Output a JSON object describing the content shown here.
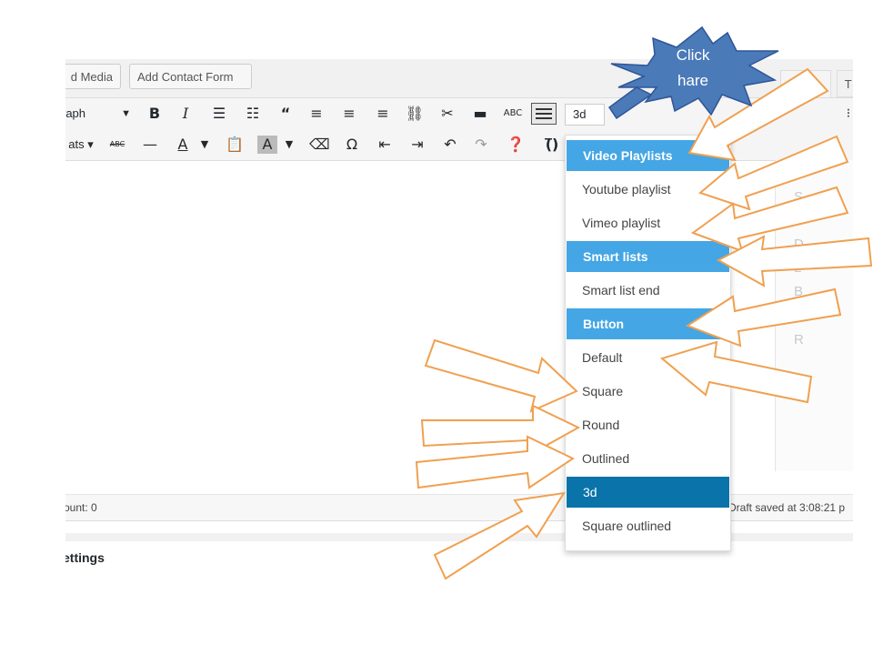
{
  "topbar": {
    "add_media_label": "d Media",
    "add_contact_form_label": "Add Contact Form",
    "tab_visual": "",
    "tab_text": "T"
  },
  "toolbar": {
    "format_select": "raph",
    "formats_label": "ats",
    "buttons_select_value": "3d",
    "icons": [
      "bold-icon",
      "italic-icon",
      "bullet-list-icon",
      "numbered-list-icon",
      "blockquote-icon",
      "align-left-icon",
      "align-center-icon",
      "align-right-icon",
      "link-icon",
      "unlink-icon",
      "read-more-icon",
      "spellcheck-icon",
      "keyboard-icon",
      "strikethrough-icon",
      "horizontal-line-icon",
      "text-color-icon",
      "paste-text-icon",
      "background-color-icon",
      "clear-format-icon",
      "omega-icon",
      "outdent-icon",
      "indent-icon",
      "undo-icon",
      "redo-icon",
      "help-icon",
      "shortcode-icon"
    ]
  },
  "dropdown": {
    "items": [
      {
        "label": "Video Playlists",
        "kind": "header"
      },
      {
        "label": "Youtube playlist",
        "kind": "item"
      },
      {
        "label": "Vimeo playlist",
        "kind": "item"
      },
      {
        "label": "Smart lists",
        "kind": "header"
      },
      {
        "label": "Smart list end",
        "kind": "item"
      },
      {
        "label": "Button",
        "kind": "header"
      },
      {
        "label": "Default",
        "kind": "item"
      },
      {
        "label": "Square",
        "kind": "item"
      },
      {
        "label": "Round",
        "kind": "item"
      },
      {
        "label": "Outlined",
        "kind": "item"
      },
      {
        "label": "3d",
        "kind": "selected"
      },
      {
        "label": "Square outlined",
        "kind": "item"
      }
    ],
    "header_color": "#44a6e4",
    "selected_color": "#0a73aa"
  },
  "sidebar_letters": [
    "S",
    "D",
    "L",
    "B",
    "A",
    "R"
  ],
  "status": {
    "word_count": "ount: 0",
    "draft_saved": "Draft saved at 3:08:21 p"
  },
  "settings_label": "ettings",
  "annotation": {
    "callout_line1": "Click",
    "callout_line2": "hare",
    "callout_color": "#4a7ab8",
    "arrow_color": "#f0a050"
  }
}
